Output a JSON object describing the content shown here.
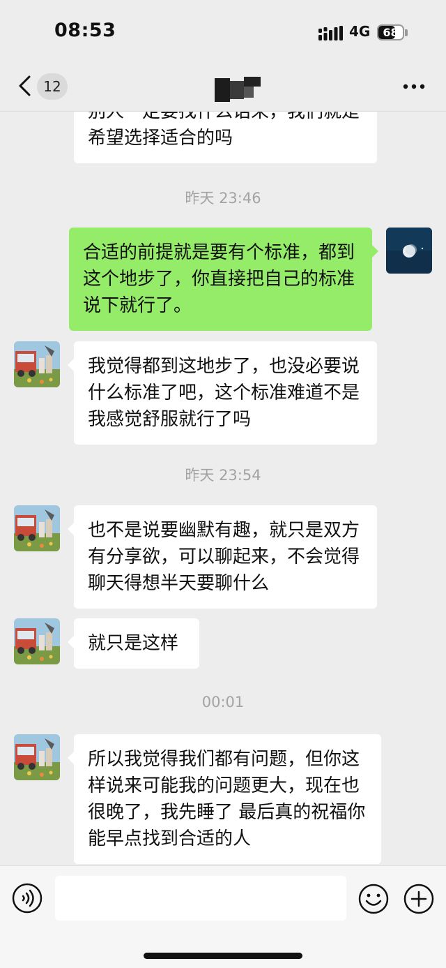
{
  "status_bar": {
    "time": "08:53",
    "network": "4G",
    "battery": "68",
    "battery_level_percent": 68
  },
  "nav": {
    "unread_count": "12"
  },
  "messages": [
    {
      "type": "in",
      "text": "别人一定要找什么话来，我们就是希望选择适合的吗"
    },
    {
      "type": "time",
      "text": "昨天 23:46"
    },
    {
      "type": "out",
      "text": "合适的前提就是要有个标准，都到这个地步了，你直接把自己的标准说下就行了。"
    },
    {
      "type": "in",
      "text": "我觉得都到这地步了，也没必要说什么标准了吧，这个标准难道不是我感觉舒服就行了吗"
    },
    {
      "type": "time",
      "text": "昨天 23:54"
    },
    {
      "type": "in",
      "text": "也不是说要幽默有趣，就只是双方有分享欲，可以聊起来，不会觉得聊天得想半天要聊什么"
    },
    {
      "type": "in",
      "text": "就只是这样"
    },
    {
      "type": "time",
      "text": "00:01"
    },
    {
      "type": "in",
      "text": "所以我觉得我们都有问题，但你这样说来可能我的问题更大，现在也很晚了，我先睡了 最后真的祝福你能早点找到合适的人"
    }
  ],
  "input": {
    "value": ""
  },
  "icons": {
    "back": "chevron-left-icon",
    "more": "more-dots-icon",
    "voice": "voice-icon",
    "emoji": "emoji-icon",
    "plus": "plus-icon"
  },
  "colors": {
    "background": "#ededed",
    "outgoing_bubble": "#95ec69",
    "incoming_bubble": "#ffffff",
    "timestamp_text": "#a3a3a3"
  }
}
